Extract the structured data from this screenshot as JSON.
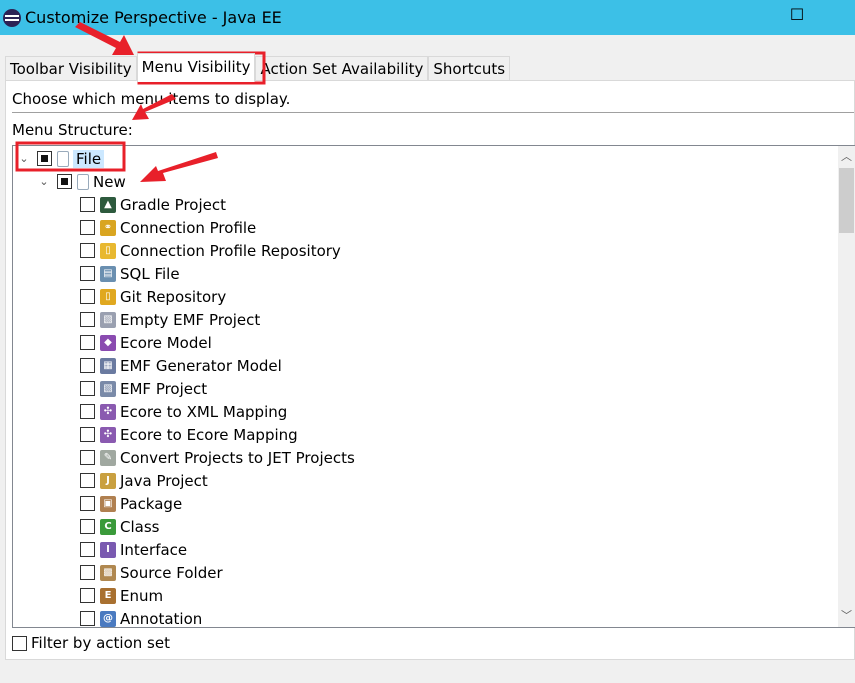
{
  "window": {
    "title": "Customize Perspective - Java EE",
    "minimize": "—",
    "maximize": "☐"
  },
  "tabs": [
    {
      "label": "Toolbar Visibility"
    },
    {
      "label": "Menu Visibility",
      "active": true
    },
    {
      "label": "Action Set Availability"
    },
    {
      "label": "Shortcuts"
    }
  ],
  "description": "Choose which menu items to display.",
  "menu_structure_label": "Menu Structure:",
  "tree": {
    "file": {
      "label": "File",
      "state": "partial"
    },
    "new": {
      "label": "New",
      "state": "partial"
    },
    "items": [
      {
        "label": "Gradle Project",
        "icon": "gradle-icon",
        "color": "#2d5a3d",
        "glyph": "▲"
      },
      {
        "label": "Connection Profile",
        "icon": "connection-profile-icon",
        "color": "#d9a520",
        "glyph": "⚭"
      },
      {
        "label": "Connection Profile Repository",
        "icon": "repository-icon",
        "color": "#e8b830",
        "glyph": "▯"
      },
      {
        "label": "SQL File",
        "icon": "sql-file-icon",
        "color": "#6a8fb0",
        "glyph": "▤"
      },
      {
        "label": "Git Repository",
        "icon": "git-repository-icon",
        "color": "#e0a820",
        "glyph": "▯"
      },
      {
        "label": "Empty EMF Project",
        "icon": "emf-project-icon",
        "color": "#9aa0b0",
        "glyph": "▧"
      },
      {
        "label": "Ecore Model",
        "icon": "ecore-model-icon",
        "color": "#8a4bb0",
        "glyph": "◆"
      },
      {
        "label": "EMF Generator Model",
        "icon": "emf-generator-icon",
        "color": "#6a7aa0",
        "glyph": "▦"
      },
      {
        "label": "EMF Project",
        "icon": "emf-project-icon",
        "color": "#7a8aa8",
        "glyph": "▧"
      },
      {
        "label": "Ecore to XML Mapping",
        "icon": "mapping-icon",
        "color": "#8a5ab0",
        "glyph": "✣"
      },
      {
        "label": "Ecore to Ecore Mapping",
        "icon": "mapping-icon",
        "color": "#8a5ab0",
        "glyph": "✣"
      },
      {
        "label": "Convert Projects to JET Projects",
        "icon": "jet-convert-icon",
        "color": "#a0a8a0",
        "glyph": "✎"
      },
      {
        "label": "Java Project",
        "icon": "java-project-icon",
        "color": "#c9a040",
        "glyph": "J"
      },
      {
        "label": "Package",
        "icon": "package-icon",
        "color": "#b08050",
        "glyph": "▣"
      },
      {
        "label": "Class",
        "icon": "class-icon",
        "color": "#3a9a3a",
        "glyph": "C"
      },
      {
        "label": "Interface",
        "icon": "interface-icon",
        "color": "#7a5ab0",
        "glyph": "I"
      },
      {
        "label": "Source Folder",
        "icon": "source-folder-icon",
        "color": "#b08850",
        "glyph": "▩"
      },
      {
        "label": "Enum",
        "icon": "enum-icon",
        "color": "#a87030",
        "glyph": "E"
      },
      {
        "label": "Annotation",
        "icon": "annotation-icon",
        "color": "#4a7ac0",
        "glyph": "@"
      }
    ]
  },
  "filter": {
    "label": "Filter by action set",
    "checked": false
  },
  "annotation_color": "#e8202a"
}
